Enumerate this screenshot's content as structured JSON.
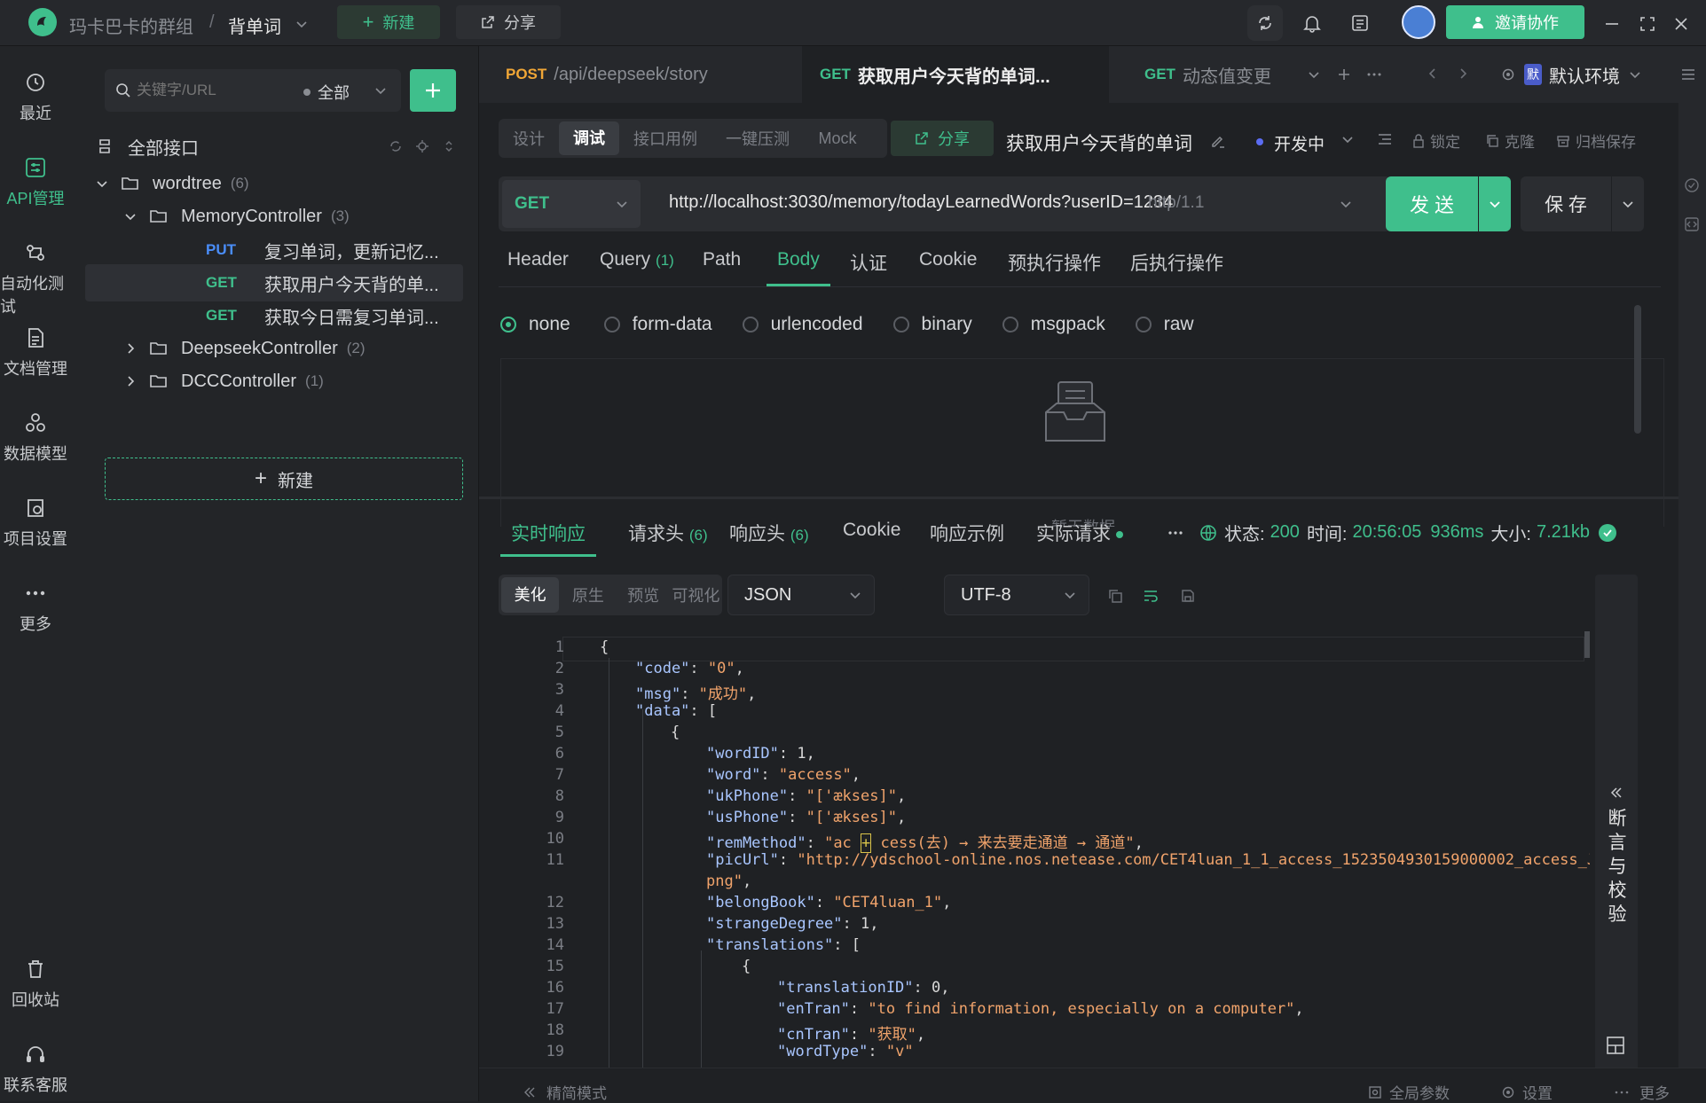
{
  "topbar": {
    "team": "玛卡巴卡的群组",
    "separator": "/",
    "project": "背单词",
    "new_label": "新建",
    "share_label": "分享",
    "invite_label": "邀请协作"
  },
  "leftnav": {
    "items": [
      {
        "label": "最近",
        "icon": "clock-icon"
      },
      {
        "label": "API管理",
        "icon": "api-icon"
      },
      {
        "label": "自动化测试",
        "icon": "automation-icon"
      },
      {
        "label": "文档管理",
        "icon": "document-icon"
      },
      {
        "label": "数据模型",
        "icon": "data-model-icon"
      },
      {
        "label": "项目设置",
        "icon": "settings-icon"
      },
      {
        "label": "更多",
        "icon": "more-icon"
      }
    ],
    "bottom_items": [
      {
        "label": "回收站",
        "icon": "trash-icon"
      },
      {
        "label": "联系客服",
        "icon": "headset-icon"
      }
    ]
  },
  "sidebar": {
    "search_placeholder": "关键字/URL",
    "filter_label": "全部",
    "all_interfaces": "全部接口",
    "tree": {
      "root": {
        "label": "wordtree",
        "count": "(6)"
      },
      "memory": {
        "label": "MemoryController",
        "count": "(3)"
      },
      "apis": [
        {
          "method": "PUT",
          "label": "复习单词，更新记忆..."
        },
        {
          "method": "GET",
          "label": "获取用户今天背的单..."
        },
        {
          "method": "GET",
          "label": "获取今日需复习单词..."
        }
      ],
      "deepseek": {
        "label": "DeepseekController",
        "count": "(2)"
      },
      "dcc": {
        "label": "DCCController",
        "count": "(1)"
      }
    },
    "new_label": "新建"
  },
  "tabs": [
    {
      "method": "POST",
      "label": "/api/deepseek/story"
    },
    {
      "method": "GET",
      "label": "获取用户今天背的单词..."
    },
    {
      "method": "GET",
      "label": "动态值变更"
    }
  ],
  "env": {
    "badge": "默",
    "label": "默认环境"
  },
  "modes": [
    "设计",
    "调试",
    "接口用例",
    "一键压测",
    "Mock"
  ],
  "mode_share": "分享",
  "api_name": "获取用户今天背的单词",
  "status_label": "开发中",
  "actions": {
    "lock": "锁定",
    "clone": "克隆",
    "archive": "归档保存"
  },
  "request": {
    "method": "GET",
    "url": "http://localhost:3030/memory/todayLearnedWords?userID=1234",
    "protocol": "http/1.1",
    "send": "发 送",
    "save": "保 存"
  },
  "req_tabs": [
    {
      "label": "Header"
    },
    {
      "label": "Query",
      "count": "(1)"
    },
    {
      "label": "Path"
    },
    {
      "label": "Body"
    },
    {
      "label": "认证"
    },
    {
      "label": "Cookie"
    },
    {
      "label": "预执行操作"
    },
    {
      "label": "后执行操作"
    }
  ],
  "body_types": [
    "none",
    "form-data",
    "urlencoded",
    "binary",
    "msgpack",
    "raw"
  ],
  "empty_text": "暂无数据",
  "resp_tabs": [
    {
      "label": "实时响应"
    },
    {
      "label": "请求头",
      "count": "(6)"
    },
    {
      "label": "响应头",
      "count": "(6)"
    },
    {
      "label": "Cookie"
    },
    {
      "label": "响应示例"
    },
    {
      "label": "实际请求"
    }
  ],
  "resp_status": {
    "status_label": "状态:",
    "status": "200",
    "time_label": "时间:",
    "time": "20:56:05",
    "duration": "936ms",
    "size_label": "大小:",
    "size": "7.21kb"
  },
  "view_modes": [
    "美化",
    "原生",
    "预览",
    "可视化"
  ],
  "format": "JSON",
  "encoding": "UTF-8",
  "assert_panel": "断言与校验",
  "bottom": {
    "simple_mode": "精简模式",
    "global_params": "全局参数",
    "settings": "设置",
    "more": "更多"
  }
}
